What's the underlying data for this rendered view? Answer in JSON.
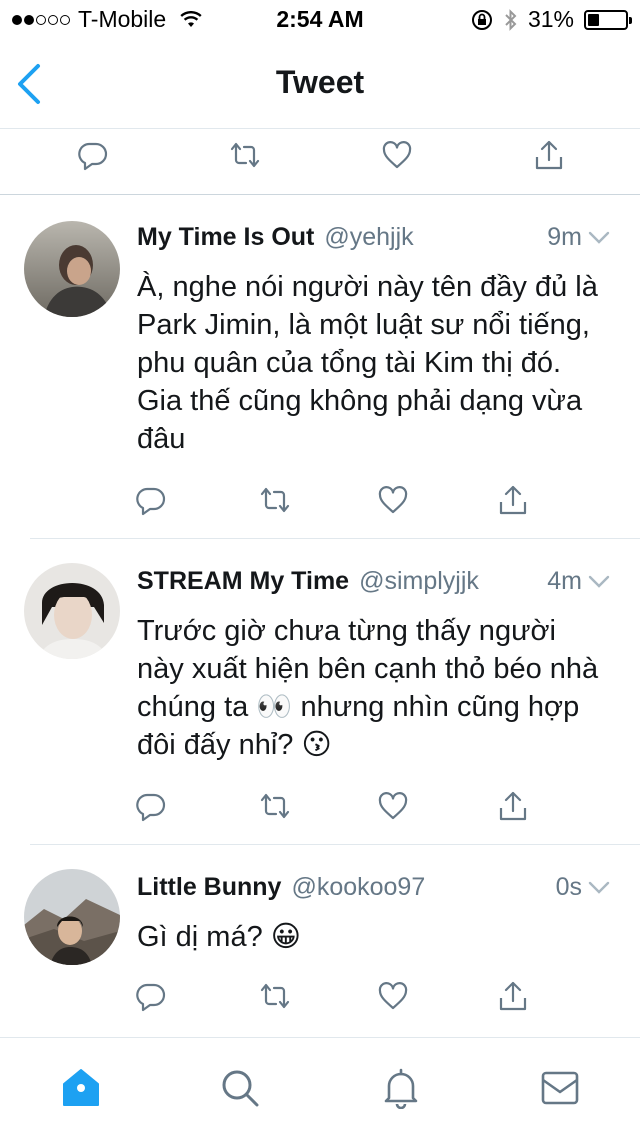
{
  "status_bar": {
    "carrier": "T-Mobile",
    "time": "2:54 AM",
    "battery": "31%",
    "battery_level": 0.31,
    "signal_dots_filled": 2,
    "signal_dots_total": 5
  },
  "nav": {
    "title": "Tweet"
  },
  "colors": {
    "accent": "#1da1f2",
    "icon_gray": "#657786",
    "divider": "#e1e8ed",
    "text": "#14171a"
  },
  "tweets": [
    {
      "name": "My Time Is Out",
      "handle": "@yehjjk",
      "time": "9m",
      "text": "À, nghe nói người này tên đầy đủ là Park Jimin, là một luật sư nổi tiếng, phu quân của tổng tài Kim thị đó. Gia thế cũng không phải dạng vừa đâu"
    },
    {
      "name": "STREAM My Time",
      "handle": "@simplyjjk",
      "time": "4m",
      "text_parts": [
        "Trước giờ chưa từng thấy người này xuất hiện bên cạnh thỏ béo nhà chúng ta ",
        "👀",
        " nhưng nhìn cũng hợp đôi đấy nhỉ? ",
        "😗"
      ]
    },
    {
      "name": "Little Bunny",
      "handle": "@kookoo97",
      "time": "0s",
      "text_parts": [
        "Gì dị má? ",
        "😀"
      ]
    }
  ],
  "icons": {
    "reply": "reply-icon",
    "retweet": "retweet-icon",
    "like": "heart-icon",
    "share": "share-icon",
    "tabs": [
      "home-icon",
      "search-icon",
      "notifications-icon",
      "messages-icon"
    ]
  }
}
